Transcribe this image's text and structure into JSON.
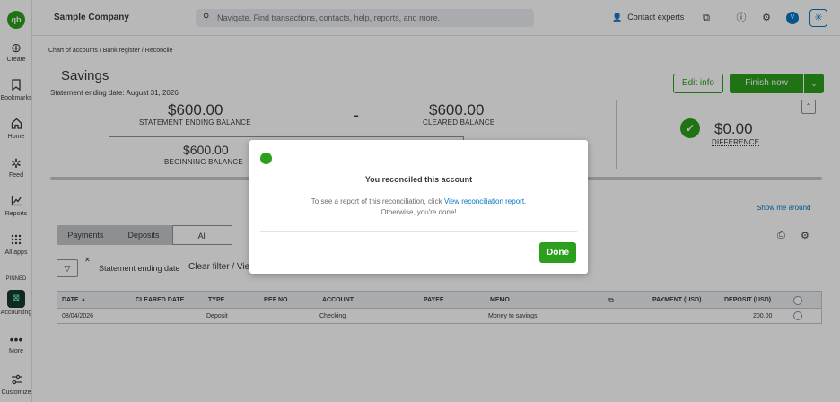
{
  "rail": {
    "logo": "qb",
    "items": [
      {
        "label": "Create",
        "icon": "plus-circle-icon",
        "glyph": "⊕"
      },
      {
        "label": "Bookmarks",
        "icon": "bookmark-icon",
        "glyph": "🔖"
      },
      {
        "label": "Home",
        "icon": "home-icon",
        "glyph": "⌂"
      },
      {
        "label": "Feed",
        "icon": "feed-icon",
        "glyph": "✲"
      },
      {
        "label": "Reports",
        "icon": "reports-icon",
        "glyph": "⟋"
      },
      {
        "label": "All apps",
        "icon": "grid-icon",
        "glyph": "⋮⋮"
      }
    ],
    "pinned_label": "PINNED",
    "accounting_label": "Accounting",
    "more_label": "More",
    "customize_label": "Customize"
  },
  "topbar": {
    "company": "Sample Company",
    "search_placeholder": "Navigate. Find transactions, contacts, help, reports, and more.",
    "contact_label": "Contact experts",
    "avatar_initial": "V"
  },
  "breadcrumb": "Chart of accounts  /  Bank register  /  Reconcile",
  "page": {
    "title": "Savings",
    "statement_date": "Statement ending date: August 31, 2026",
    "edit_info_label": "Edit info",
    "finish_label": "Finish now"
  },
  "summary": {
    "statement_ending_balance": "$600.00",
    "statement_ending_label": "STATEMENT ENDING BALANCE",
    "cleared_balance": "$600.00",
    "cleared_label": "CLEARED BALANCE",
    "beginning_balance": "$600.00",
    "beginning_label": "BEGINNING BALANCE",
    "difference": "$0.00",
    "difference_label": "DIFFERENCE",
    "minus": "-"
  },
  "show_me_around": "Show me around",
  "tabs": [
    "Payments",
    "Deposits",
    "All"
  ],
  "filter": {
    "label": "Statement ending date",
    "clear_label": "Clear filter / View all"
  },
  "table": {
    "headers": [
      "DATE ▲",
      "CLEARED DATE",
      "TYPE",
      "REF NO.",
      "ACCOUNT",
      "PAYEE",
      "MEMO",
      "PAYMENT (USD)",
      "DEPOSIT (USD)"
    ],
    "rows": [
      {
        "date": "08/04/2026",
        "cleared_date": "",
        "type": "Deposit",
        "ref": "",
        "account": "Checking",
        "payee": "",
        "memo": "Money to savings",
        "payment": "",
        "deposit": "200.00"
      }
    ]
  },
  "modal": {
    "title": "You reconciled this account",
    "line1_prefix": "To see a report of this reconciliation, click ",
    "line1_link": "View reconciliation report.",
    "line2": "Otherwise, you're done!",
    "done_label": "Done"
  },
  "colors": {
    "accent": "#2ca01c",
    "link": "#0077c5"
  }
}
